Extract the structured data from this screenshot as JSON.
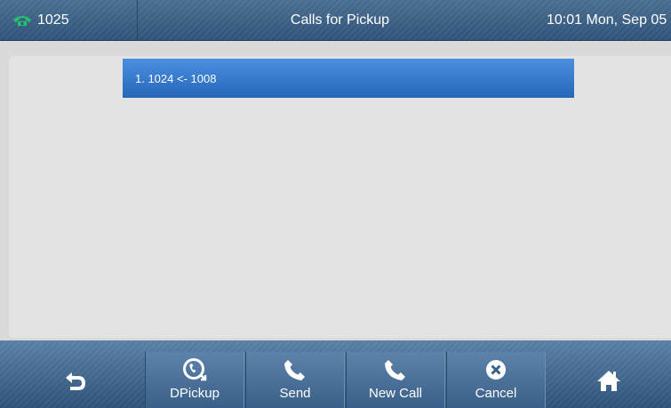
{
  "status_bar": {
    "account": "1025",
    "title": "Calls for Pickup",
    "clock": "10:01 Mon, Sep 05"
  },
  "pickup_list": {
    "items": [
      {
        "label": "1. 1024 <- 1008"
      }
    ]
  },
  "softkeys": {
    "back_icon": "back-arrow-icon",
    "dpickup_label": "DPickup",
    "send_label": "Send",
    "new_call_label": "New Call",
    "cancel_label": "Cancel",
    "home_icon": "home-icon"
  },
  "colors": {
    "bar": "#3a5f86",
    "selected_row": "#2f74cc",
    "content_bg": "#e3e3e3",
    "phone_icon": "#22c46b"
  }
}
